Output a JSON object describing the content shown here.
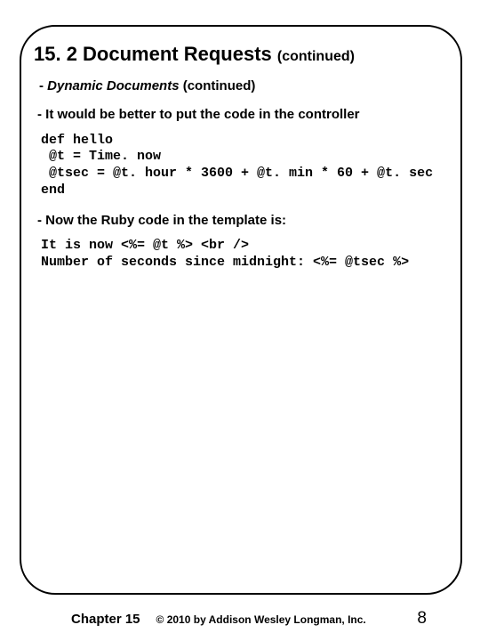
{
  "title": {
    "main": "15. 2 Document Requests ",
    "cont": "(continued)"
  },
  "subhead": {
    "dash": " - ",
    "em": "Dynamic Documents",
    "rest": " (continued)"
  },
  "bullets": {
    "b1": " - It would be better to put the code in the controller",
    "b2": " - Now the Ruby code in the template is:"
  },
  "code": {
    "block1": "def hello\n @t = Time. now\n @tsec = @t. hour * 3600 + @t. min * 60 + @t. sec\nend",
    "block2": "It is now <%= @t %> <br />\nNumber of seconds since midnight: <%= @tsec %>"
  },
  "footer": {
    "chapter": "Chapter 15",
    "copyright": "© 2010 by Addison Wesley Longman, Inc.",
    "page": "8"
  }
}
